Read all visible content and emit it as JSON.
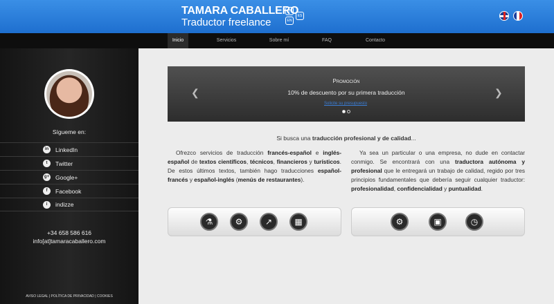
{
  "header": {
    "name": "TAMARA CABALLERO",
    "role": "Traductor freelance",
    "hex_badges": [
      "FR",
      "ES",
      "EN"
    ]
  },
  "languages": [
    {
      "icon": "uk-flag-icon",
      "label": "English"
    },
    {
      "icon": "fr-flag-icon",
      "label": "Français"
    }
  ],
  "nav": [
    "Inicio",
    "Servicios",
    "Sobre mí",
    "FAQ",
    "Contacto"
  ],
  "nav_active": "Inicio",
  "sidebar": {
    "follow": "Sígueme en:",
    "social": [
      {
        "icon": "linkedin-icon",
        "glyph": "in",
        "label": "LinkedIn"
      },
      {
        "icon": "twitter-icon",
        "glyph": "t",
        "label": "Twitter"
      },
      {
        "icon": "googleplus-icon",
        "glyph": "g+",
        "label": "Google+"
      },
      {
        "icon": "facebook-icon",
        "glyph": "f",
        "label": "Facebook"
      },
      {
        "icon": "info-icon",
        "glyph": "i",
        "label": "indizze"
      }
    ],
    "phone": "+34 658 586 616",
    "email": "info[at]tamaracaballero.com",
    "legal": "AVISO LEGAL | POLÍTICA DE PRIVACIDAD | COOKIES"
  },
  "slider": {
    "title": "Promoción",
    "subtitle": "10% de descuento por su primera traducción",
    "link": "Solicite su presupuesto"
  },
  "intro": {
    "before": "Si busca una ",
    "bold": "traducción profesional y de calidad",
    "after": "..."
  },
  "colors": {
    "header_blue": "#2a7fdf",
    "nav_dark": "#0e0e0e",
    "sidebar": "#1e1e1e"
  },
  "panels": {
    "left": [
      "flask-icon",
      "gears-icon",
      "chart-icon",
      "map-icon"
    ],
    "right": [
      "cog-icon",
      "lock-icon",
      "clock-icon"
    ]
  }
}
